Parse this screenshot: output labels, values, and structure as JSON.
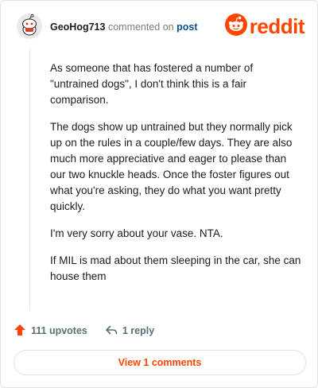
{
  "comment": {
    "username": "GeoHog713",
    "action_text": "commented on",
    "post_link": "post",
    "paragraphs": [
      "As someone that has fostered a number of \"untrained dogs\", I don't think this is a fair comparison.",
      "The dogs show up untrained but they normally pick up on the rules in a couple/few days. They are also much more appreciative and eager to please than our two knuckle heads. Once the foster figures out what you're asking, they do what you want pretty quickly.",
      "I'm very sorry about your vase. NTA.",
      "If MIL is mad about them sleeping in the car, she can house them"
    ]
  },
  "brand": {
    "logo_text": "reddit",
    "color": "#ff4500"
  },
  "actions": {
    "upvotes": "111 upvotes",
    "reply": "1 reply"
  },
  "view_comments": "View 1 comments",
  "icons": [
    "avatar",
    "reddit-snoo-icon",
    "upvote-arrow-icon",
    "reply-icon"
  ]
}
